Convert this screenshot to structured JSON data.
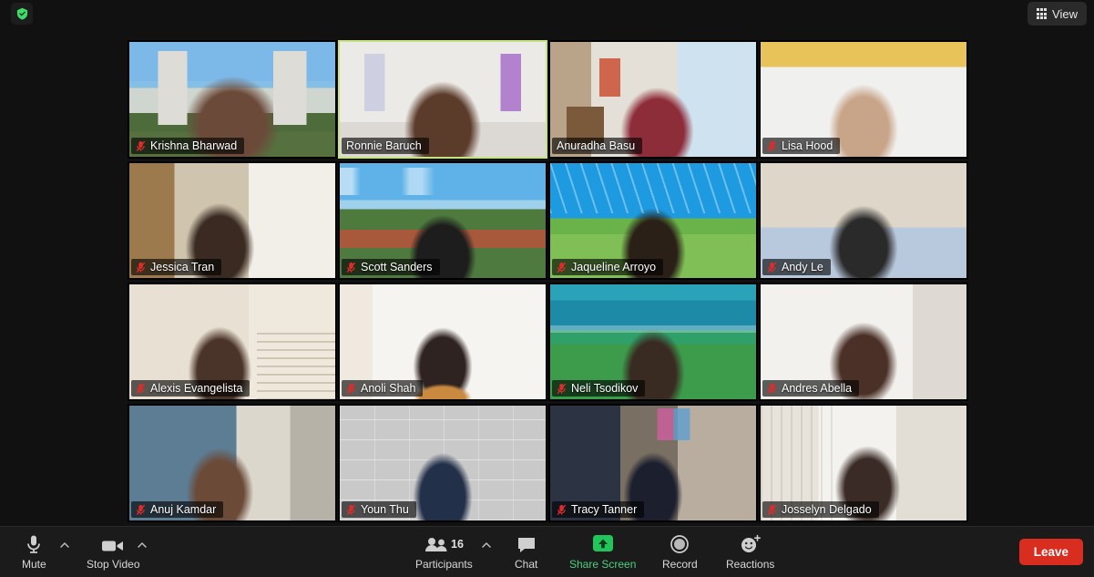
{
  "app": {
    "name": "Zoom Meeting",
    "background_color": "#111111"
  },
  "topbar": {
    "security_icon": "shield-check-icon",
    "security_color": "#3ddc6b",
    "view_button": {
      "label": "View",
      "icon": "grid-view-icon"
    }
  },
  "grid": {
    "columns": 4,
    "rows": 4,
    "active_speaker_border_color": "#c5e384",
    "muted_icon": "microphone-muted-icon",
    "muted_icon_color": "#e02b2b",
    "participants": [
      {
        "name": "Krishna Bharwad",
        "muted": true,
        "active_speaker": false,
        "scene": "church-towers-outdoor"
      },
      {
        "name": "Ronnie Baruch",
        "muted": false,
        "active_speaker": true,
        "scene": "white-room-interior"
      },
      {
        "name": "Anuradha Basu",
        "muted": false,
        "active_speaker": false,
        "scene": "bookshelf-living-room"
      },
      {
        "name": "Lisa Hood",
        "muted": true,
        "active_speaker": false,
        "scene": "yellow-wall-indoor"
      },
      {
        "name": "Jessica Tran",
        "muted": true,
        "active_speaker": false,
        "scene": "bedroom-window-light"
      },
      {
        "name": "Scott Sanders",
        "muted": true,
        "active_speaker": false,
        "scene": "campus-aerial-virtual-bg"
      },
      {
        "name": "Jaqueline Arroyo",
        "muted": true,
        "active_speaker": false,
        "scene": "blue-sky-campus-virtual-bg"
      },
      {
        "name": "Andy Le",
        "muted": true,
        "active_speaker": false,
        "scene": "plain-beige-wall"
      },
      {
        "name": "Alexis Evangelista",
        "muted": true,
        "active_speaker": false,
        "scene": "staircase-hallway"
      },
      {
        "name": "Anoli Shah",
        "muted": true,
        "active_speaker": false,
        "scene": "white-wall-doorway"
      },
      {
        "name": "Neli Tsodikov",
        "muted": true,
        "active_speaker": false,
        "scene": "ocean-coastline-virtual-bg"
      },
      {
        "name": "Andres Abella",
        "muted": true,
        "active_speaker": false,
        "scene": "white-room-sofa"
      },
      {
        "name": "Anuj Kamdar",
        "muted": true,
        "active_speaker": false,
        "scene": "blue-wall-bedroom"
      },
      {
        "name": "Youn Thu",
        "muted": true,
        "active_speaker": false,
        "scene": "sjsu-branded-backdrop"
      },
      {
        "name": "Tracy Tanner",
        "muted": true,
        "active_speaker": false,
        "scene": "home-office-desk"
      },
      {
        "name": "Josselyn Delgado",
        "muted": true,
        "active_speaker": false,
        "scene": "white-curtain-room"
      }
    ]
  },
  "toolbar": {
    "mute": {
      "label": "Mute",
      "icon": "microphone-icon",
      "has_caret": true
    },
    "stop_video": {
      "label": "Stop Video",
      "icon": "video-camera-icon",
      "has_caret": true
    },
    "participants": {
      "label": "Participants",
      "icon": "people-icon",
      "count": "16",
      "has_caret": true
    },
    "chat": {
      "label": "Chat",
      "icon": "chat-bubble-icon",
      "has_caret": false
    },
    "share_screen": {
      "label": "Share Screen",
      "icon": "share-up-arrow-icon",
      "has_caret": false,
      "color": "#4ad17c"
    },
    "record": {
      "label": "Record",
      "icon": "record-circle-icon",
      "has_caret": false
    },
    "reactions": {
      "label": "Reactions",
      "icon": "smiley-plus-icon",
      "has_caret": false
    },
    "leave": {
      "label": "Leave",
      "color": "#d92d20"
    }
  }
}
